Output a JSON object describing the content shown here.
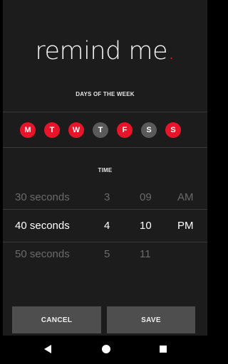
{
  "app": {
    "title": "remind me",
    "title_dot": ".",
    "accent_color": "#e8142a"
  },
  "days_section": {
    "label": "DAYS OF THE WEEK",
    "days": [
      {
        "letter": "M",
        "selected": true
      },
      {
        "letter": "T",
        "selected": true
      },
      {
        "letter": "W",
        "selected": true
      },
      {
        "letter": "T",
        "selected": false
      },
      {
        "letter": "F",
        "selected": true
      },
      {
        "letter": "S",
        "selected": false
      },
      {
        "letter": "S",
        "selected": true
      }
    ]
  },
  "time_section": {
    "label": "TIME",
    "rows": [
      {
        "duration": "30 seconds",
        "hour": "3",
        "minute": "09",
        "period": "AM"
      },
      {
        "duration": "40 seconds",
        "hour": "4",
        "minute": "10",
        "period": "PM"
      },
      {
        "duration": "50 seconds",
        "hour": "5",
        "minute": "11",
        "period": ""
      }
    ]
  },
  "buttons": {
    "cancel": "CANCEL",
    "save": "SAVE"
  },
  "navbar": {
    "back_icon": "back-triangle-icon",
    "home_icon": "home-circle-icon",
    "recents_icon": "recents-square-icon"
  }
}
